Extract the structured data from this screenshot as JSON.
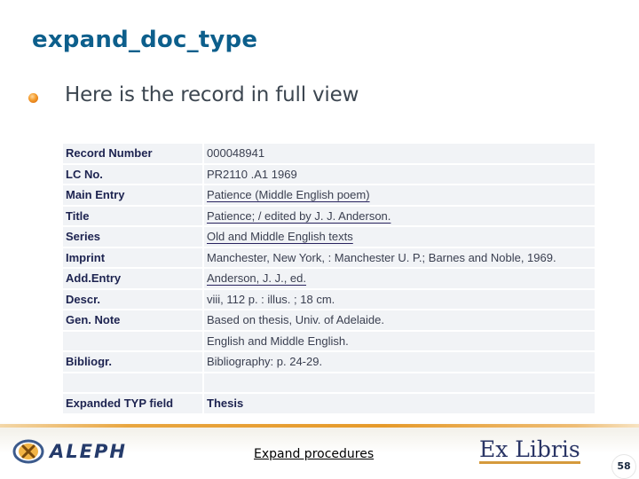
{
  "slide": {
    "title": "expand_doc_type",
    "bullet": "Here is the record in full view",
    "page_number": "58"
  },
  "record": {
    "rows": [
      {
        "label": "Record Number",
        "value": "000048941",
        "link": false,
        "bold": false
      },
      {
        "label": "LC No.",
        "value": "PR2110 .A1 1969",
        "link": false,
        "bold": false
      },
      {
        "label": "Main Entry",
        "value": "Patience (Middle English poem)",
        "link": true,
        "bold": false
      },
      {
        "label": "Title",
        "value": "Patience; / edited by J. J. Anderson.",
        "link": true,
        "bold": false
      },
      {
        "label": "Series",
        "value": "Old and Middle English texts",
        "link": true,
        "bold": false
      },
      {
        "label": "Imprint",
        "value": "Manchester, New York, : Manchester U. P.; Barnes and Noble, 1969.",
        "link": false,
        "bold": false
      },
      {
        "label": "Add.Entry",
        "value": "Anderson, J. J., ed.",
        "link": true,
        "bold": false
      },
      {
        "label": "Descr.",
        "value": "viii, 112 p. :  illus. ;  18 cm.",
        "link": false,
        "bold": false
      },
      {
        "label": "Gen. Note",
        "value": "Based on thesis, Univ. of Adelaide.",
        "link": false,
        "bold": false
      },
      {
        "label": "",
        "value": "English and Middle English.",
        "link": false,
        "bold": false
      },
      {
        "label": "Bibliogr.",
        "value": "Bibliography: p. 24-29.",
        "link": false,
        "bold": false
      },
      {
        "label": "",
        "value": "",
        "link": false,
        "bold": false
      },
      {
        "label": "Expanded TYP field",
        "value": "Thesis",
        "link": false,
        "bold": true
      }
    ]
  },
  "footer": {
    "left_logo": "ALEPH",
    "left_logo_icon": "aleph-emblem-icon",
    "link": "Expand procedures",
    "right_logo": "Ex Libris"
  },
  "colors": {
    "title": "#0d5f8c",
    "bullet": "#f39a2a",
    "accent_line": "#e69a2a",
    "cell_bg": "#f1f3f6",
    "label_text": "#1d2350"
  }
}
